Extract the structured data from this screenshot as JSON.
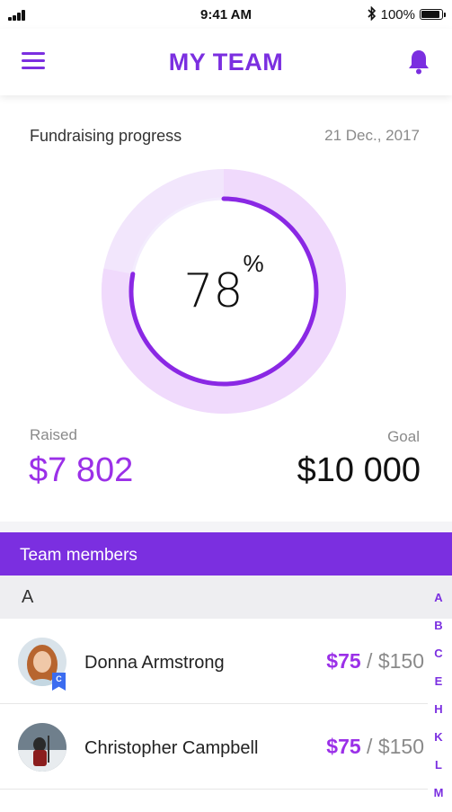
{
  "status_bar": {
    "time": "9:41 AM",
    "battery": "100%",
    "battery_level": 1.0
  },
  "header": {
    "title": "MY TEAM",
    "menu_icon": "hamburger-icon",
    "bell_icon": "bell-icon"
  },
  "fundraising": {
    "label": "Fundraising progress",
    "date": "21 Dec., 2017",
    "percent": "78",
    "percent_sign": "%",
    "progress": 0.78,
    "raised_label": "Raised",
    "raised_value": "$7 802",
    "goal_label": "Goal",
    "goal_value": "$10 000"
  },
  "team": {
    "title": "Team members",
    "section_letter": "A",
    "members": [
      {
        "name": "Donna Armstrong",
        "raised": "$75",
        "separator": " / ",
        "goal": "$150",
        "badge": "C"
      },
      {
        "name": "Christopher Campbell",
        "raised": "$75",
        "separator": " / ",
        "goal": "$150"
      }
    ]
  },
  "alpha_index": [
    "A",
    "B",
    "C",
    "E",
    "H",
    "K",
    "L",
    "M"
  ],
  "colors": {
    "accent": "#7B2FE0",
    "raised": "#9B30E8",
    "ring_bg": "#F2E6FC",
    "badge": "#3B6CF0"
  }
}
